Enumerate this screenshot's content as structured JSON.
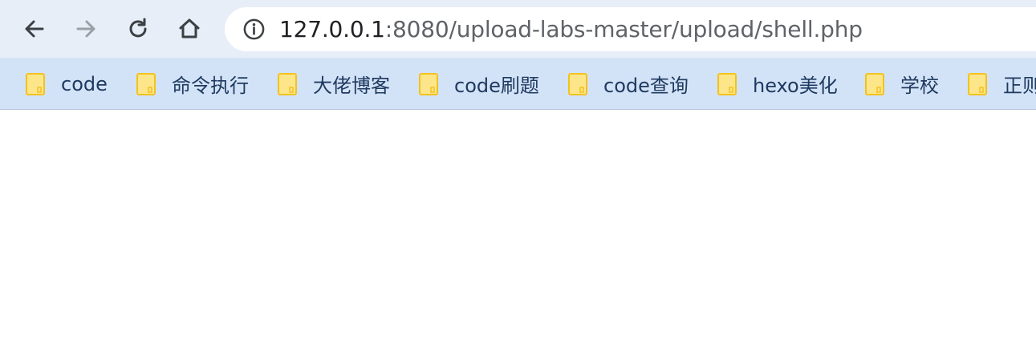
{
  "toolbar": {
    "back_icon": "arrow-left-icon",
    "forward_icon": "arrow-right-icon",
    "reload_icon": "reload-icon",
    "home_icon": "home-icon",
    "colors": {
      "icon_active": "#3c4043",
      "icon_disabled": "#9aa0a6"
    }
  },
  "address_bar": {
    "info_icon": "info-icon",
    "host": "127.0.0.1",
    "rest": ":8080/upload-labs-master/upload/shell.php"
  },
  "bookmarks": [
    {
      "label": "code"
    },
    {
      "label": "命令执行"
    },
    {
      "label": "大佬博客"
    },
    {
      "label": "code刷题"
    },
    {
      "label": "code查询"
    },
    {
      "label": "hexo美化"
    },
    {
      "label": "学校"
    },
    {
      "label": "正则"
    }
  ],
  "colors": {
    "toolbar_bg": "#e8eef8",
    "bookmarks_bg": "#d3e3f7",
    "folder": "#fde68a",
    "folder_border": "#f3c220"
  }
}
